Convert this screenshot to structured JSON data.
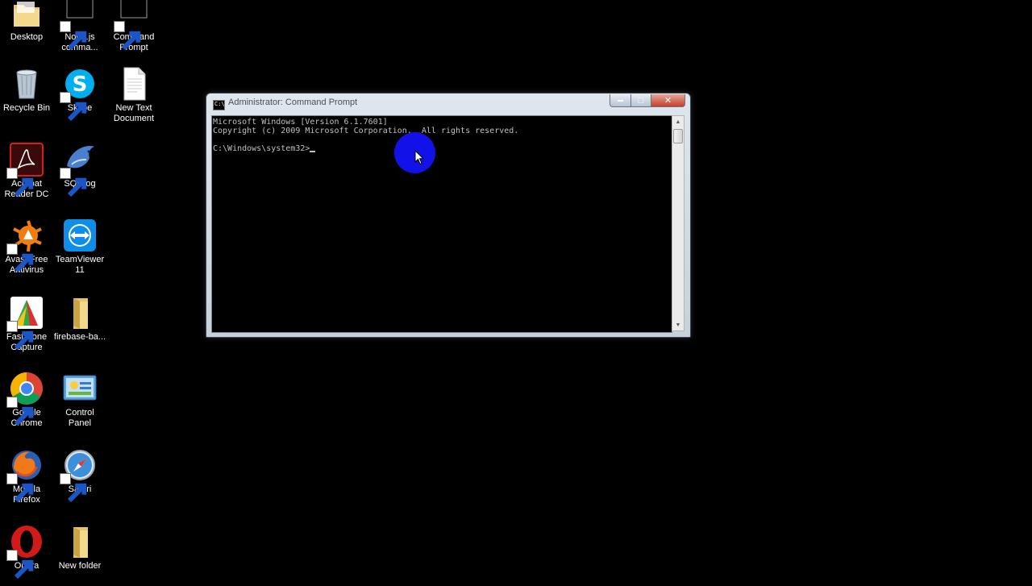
{
  "desktop": {
    "icons": [
      {
        "label": "Desktop",
        "icon": "folder-icon"
      },
      {
        "label": "Node.js\ncomma...",
        "icon": "nodejs-cmd-icon"
      },
      {
        "label": "Command\nPrompt",
        "icon": "command-prompt-icon"
      },
      {
        "label": "Recycle Bin",
        "icon": "recycle-bin-icon"
      },
      {
        "label": "Skype",
        "icon": "skype-icon"
      },
      {
        "label": "New Text\nDocument",
        "icon": "text-document-icon"
      },
      {
        "label": "Acrobat\nReader DC",
        "icon": "acrobat-icon"
      },
      {
        "label": "SQLyog",
        "icon": "sqlyog-dolphin-icon"
      },
      {
        "label": "Avast Free\nAntivirus",
        "icon": "avast-icon"
      },
      {
        "label": "TeamViewer\n11",
        "icon": "teamviewer-icon"
      },
      {
        "label": "FastStone\nCapture",
        "icon": "faststone-icon"
      },
      {
        "label": "firebase-ba...",
        "icon": "folder-icon"
      },
      {
        "label": "Google\nChrome",
        "icon": "chrome-icon"
      },
      {
        "label": "Control\nPanel",
        "icon": "control-panel-icon"
      },
      {
        "label": "Mozilla\nFirefox",
        "icon": "firefox-icon"
      },
      {
        "label": "Safari",
        "icon": "safari-icon"
      },
      {
        "label": "Opera",
        "icon": "opera-icon"
      },
      {
        "label": "New folder",
        "icon": "folder-icon"
      }
    ]
  },
  "window": {
    "title": "Administrator: Command Prompt",
    "icon_glyph": "C:\\",
    "console": {
      "lines": [
        "Microsoft Windows [Version 6.1.7601]",
        "Copyright (c) 2009 Microsoft Corporation.  All rights reserved.",
        "",
        "C:\\Windows\\system32>"
      ]
    },
    "buttons": {
      "minimize": "▬",
      "maximize": "□",
      "close": "✕"
    },
    "scrollbar": {
      "up": "▲",
      "down": "▼"
    }
  },
  "colors": {
    "desktop_bg": "#000000",
    "console_text": "#c0c0c0",
    "close_red": "#c7402a",
    "cursor_highlight": "#1212e8"
  }
}
